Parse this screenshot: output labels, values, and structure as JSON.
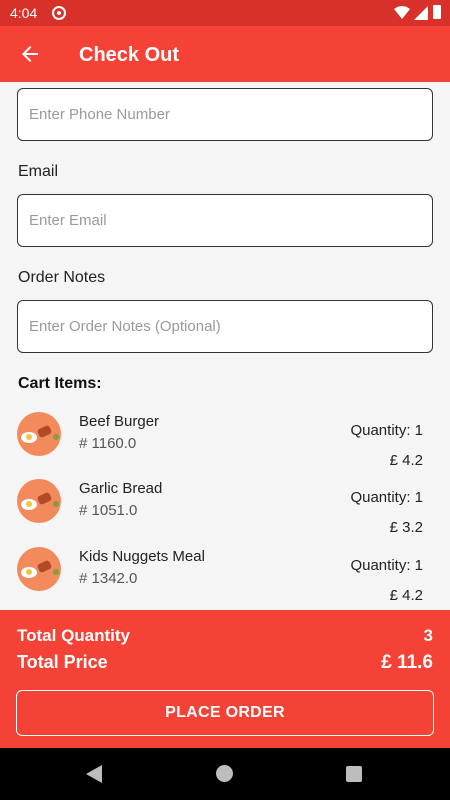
{
  "status_bar": {
    "time": "4:04"
  },
  "app_bar": {
    "title": "Check Out"
  },
  "form": {
    "phone_placeholder": "Enter Phone Number",
    "email_label": "Email",
    "email_placeholder": "Enter Email",
    "notes_label": "Order Notes",
    "notes_placeholder": "Enter Order Notes (Optional)"
  },
  "cart": {
    "title": "Cart Items:",
    "items": [
      {
        "name": "Beef Burger",
        "id": "# 1160.0",
        "quantity": "Quantity: 1",
        "price": "£ 4.2"
      },
      {
        "name": "Garlic Bread",
        "id": "# 1051.0",
        "quantity": "Quantity: 1",
        "price": "£ 3.2"
      },
      {
        "name": "Kids Nuggets Meal",
        "id": "# 1342.0",
        "quantity": "Quantity: 1",
        "price": "£ 4.2"
      }
    ]
  },
  "summary": {
    "total_quantity_label": "Total Quantity",
    "total_quantity_value": "3",
    "total_price_label": "Total Price",
    "total_price_value": "£ 11.6",
    "place_order_label": "PLACE ORDER"
  },
  "colors": {
    "primary": "#f44236",
    "status_bar": "#d8312a"
  }
}
